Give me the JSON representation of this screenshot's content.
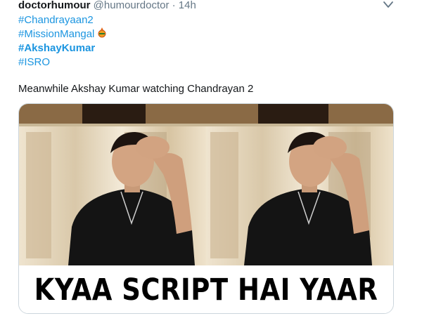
{
  "tweet": {
    "user_name": "doctorhumour",
    "user_handle": "@humourdoctor",
    "separator": "·",
    "timestamp": "14h",
    "hashtags": [
      "#Chandrayaan2",
      "#MissionMangal",
      "#AkshayKumar",
      "#ISRO"
    ],
    "text": "Meanwhile Akshay Kumar watching Chandrayan 2",
    "media": {
      "caption": "KYAA SCRIPT HAI YAAR",
      "image": "meme-photo-two-panel"
    }
  },
  "colors": {
    "link": "#1b95e0",
    "secondary_text": "#657786",
    "card_border": "#ccd6dd"
  },
  "icons": [
    "chevron-down-icon",
    "mission-mangal-emoji-icon"
  ]
}
